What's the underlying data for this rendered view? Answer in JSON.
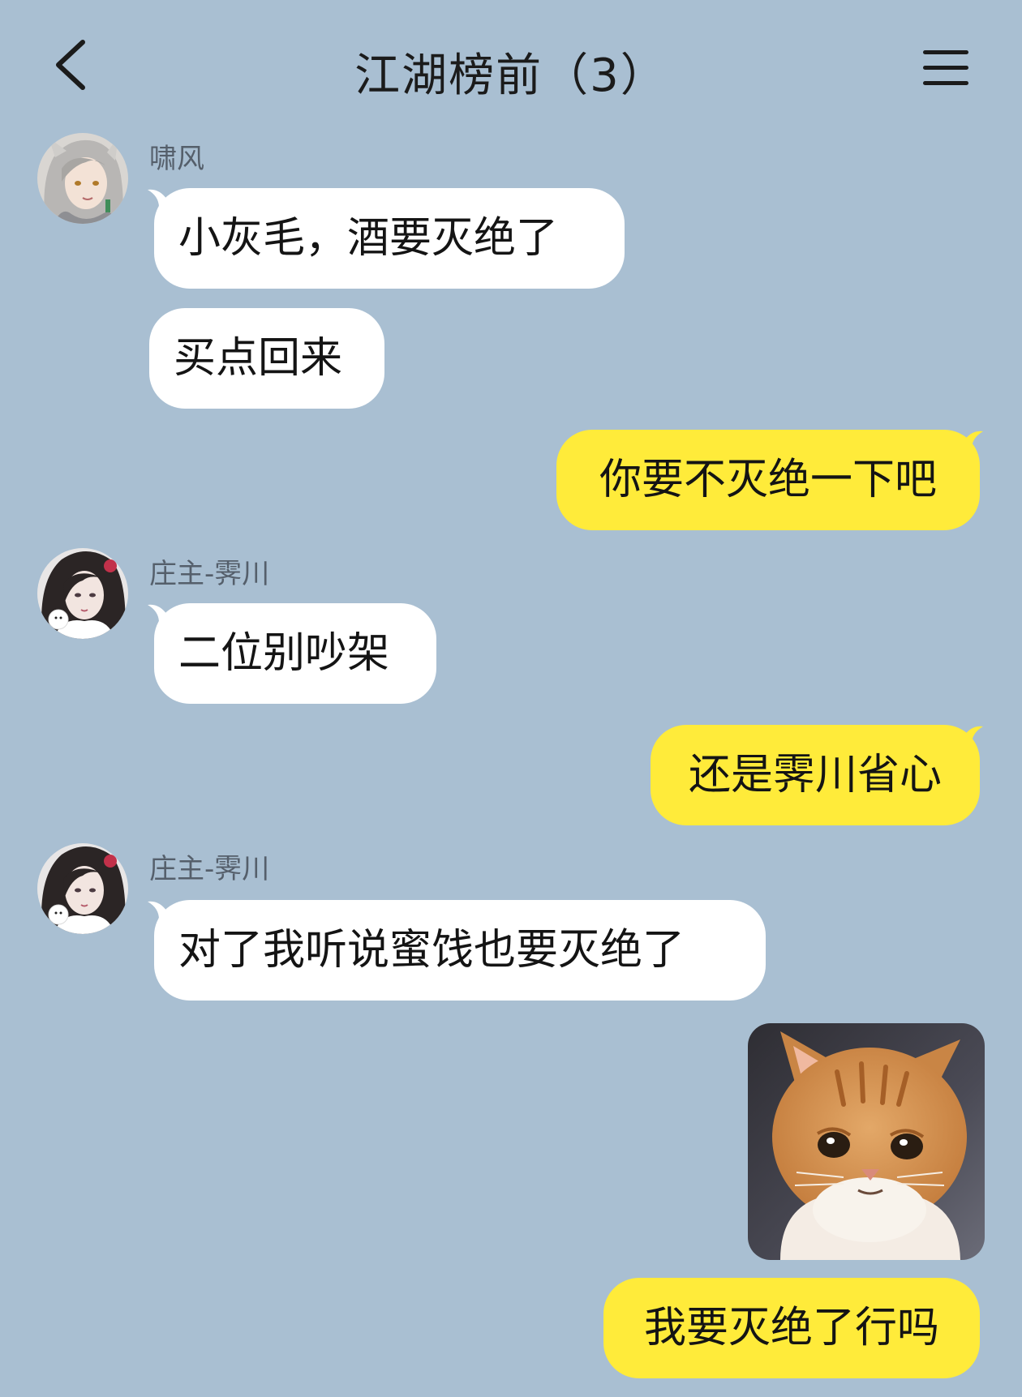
{
  "header": {
    "title": "江湖榜前（3）",
    "back_icon": "chevron-left-icon",
    "menu_icon": "menu-icon"
  },
  "messages": [
    {
      "type": "sender",
      "name": "啸风"
    },
    {
      "type": "text",
      "side": "left",
      "text": "小灰毛，酒要灭绝了"
    },
    {
      "type": "text",
      "side": "left",
      "text": "买点回来"
    },
    {
      "type": "text",
      "side": "right",
      "text": "你要不灭绝一下吧"
    },
    {
      "type": "sender",
      "name": "庄主-霁川"
    },
    {
      "type": "text",
      "side": "left",
      "text": "二位别吵架"
    },
    {
      "type": "text",
      "side": "right",
      "text": "还是霁川省心"
    },
    {
      "type": "sender",
      "name": "庄主-霁川"
    },
    {
      "type": "text",
      "side": "left",
      "text": "对了我听说蜜饯也要灭绝了"
    },
    {
      "type": "image",
      "side": "right",
      "description_icon": "sad-cat-sticker"
    },
    {
      "type": "text",
      "side": "right",
      "text": "我要灭绝了行吗"
    }
  ],
  "colors": {
    "background": "#a9bfd2",
    "incoming_bubble": "#ffffff",
    "outgoing_bubble": "#ffeb3a"
  }
}
